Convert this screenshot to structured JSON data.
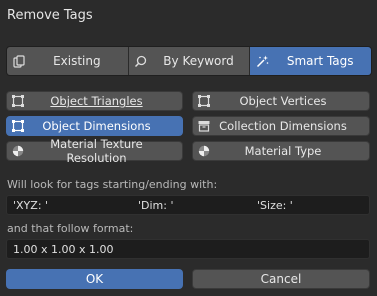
{
  "dialog": {
    "title": "Remove Tags"
  },
  "modes": {
    "items": [
      {
        "label": "Existing",
        "icon": "duplicate-icon"
      },
      {
        "label": "By Keyword",
        "icon": "search-icon"
      },
      {
        "label": "Smart Tags",
        "icon": "magic-wand-icon",
        "selected": true
      }
    ]
  },
  "tag_types": {
    "items": [
      {
        "label": "Object Triangles",
        "icon": "mesh-object-icon",
        "selected": false
      },
      {
        "label": "Object Vertices",
        "icon": "mesh-object-icon",
        "selected": false
      },
      {
        "label": "Object Dimensions",
        "icon": "mesh-object-icon",
        "selected": true
      },
      {
        "label": "Collection Dimensions",
        "icon": "collection-box-icon",
        "selected": false
      },
      {
        "label": "Material Texture Resolution",
        "icon": "material-sphere-icon",
        "selected": false
      },
      {
        "label": "Material Type",
        "icon": "material-sphere-icon",
        "selected": false
      }
    ]
  },
  "prefix": {
    "caption": "Will look for tags starting/ending with:",
    "values": [
      "'XYZ: '",
      "'Dim: '",
      "'Size: '"
    ]
  },
  "format": {
    "caption": "and that follow format:",
    "value": "1.00 x 1.00 x 1.00"
  },
  "footer": {
    "ok_label": "OK",
    "cancel_label": "Cancel"
  },
  "colors": {
    "accent": "#4772b3",
    "button": "#545454",
    "background": "#2b2b2b",
    "field": "#1d1d1d"
  }
}
